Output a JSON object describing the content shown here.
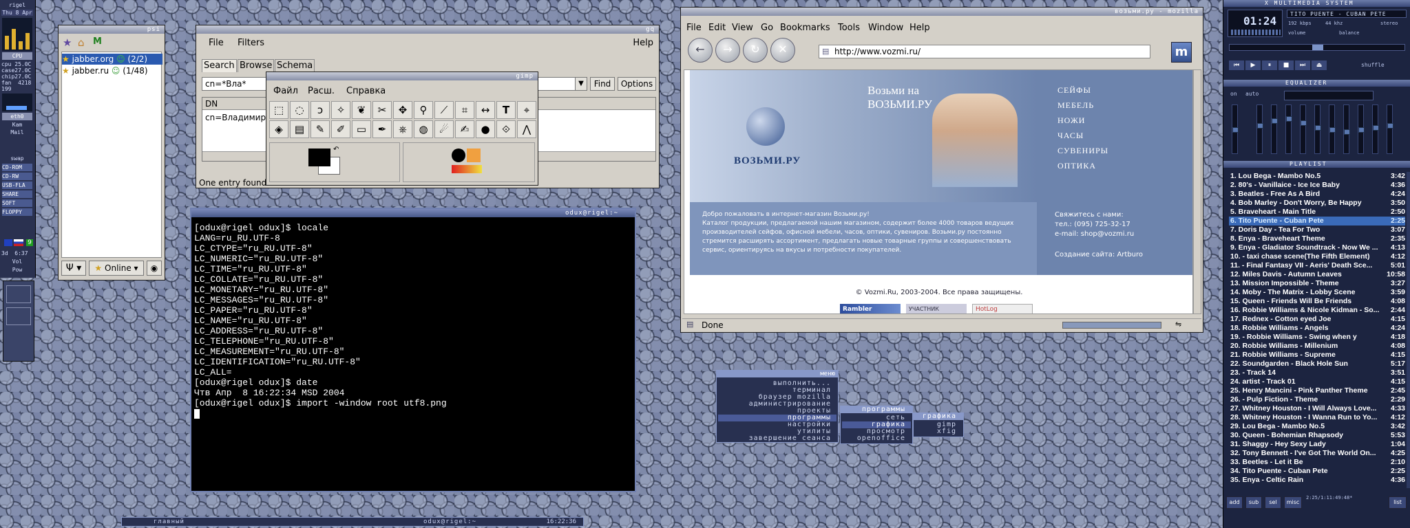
{
  "dock": {
    "host": "rigel",
    "date": "Thu 8 Apr",
    "cpu_label": "CPU",
    "cpu_lines": "cpu 25.0C\ncase27.0C\nchip27.0C\nfan  4218\n199",
    "net": "eth0",
    "net2": "Kam",
    "mail": "Mail",
    "swap": "swap",
    "drives": [
      "CD-ROM",
      "CD-RW",
      "USB-FLA",
      "SHARE",
      "SOFT",
      "FLOPPY"
    ],
    "clock": "3d  6:37",
    "kbd": "9",
    "vol": "Vol",
    "pow": "Pow"
  },
  "psi": {
    "title": "psi",
    "accounts": [
      {
        "name": "jabber.org",
        "count": "(2/2)"
      },
      {
        "name": "jabber.ru",
        "count": "(1/48)"
      }
    ],
    "status": "Online"
  },
  "gq": {
    "title": "gq",
    "menu": [
      "File",
      "Filters"
    ],
    "help": "Help",
    "tabs": [
      "Search",
      "Browse",
      "Schema"
    ],
    "search_value": "cn=*Вла*",
    "find_label": "Find",
    "options_label": "Options",
    "column_header": "DN",
    "result": "cn=Владимир",
    "status": "One entry found"
  },
  "gimp": {
    "title": "gimp",
    "menu": [
      "Файл",
      "Расш.",
      "Справка"
    ]
  },
  "terminal": {
    "title": "odux@rigel:~",
    "lines": [
      "[odux@rigel odux]$ locale",
      "LANG=ru_RU.UTF-8",
      "LC_CTYPE=\"ru_RU.UTF-8\"",
      "LC_NUMERIC=\"ru_RU.UTF-8\"",
      "LC_TIME=\"ru_RU.UTF-8\"",
      "LC_COLLATE=\"ru_RU.UTF-8\"",
      "LC_MONETARY=\"ru_RU.UTF-8\"",
      "LC_MESSAGES=\"ru_RU.UTF-8\"",
      "LC_PAPER=\"ru_RU.UTF-8\"",
      "LC_NAME=\"ru_RU.UTF-8\"",
      "LC_ADDRESS=\"ru_RU.UTF-8\"",
      "LC_TELEPHONE=\"ru_RU.UTF-8\"",
      "LC_MEASUREMENT=\"ru_RU.UTF-8\"",
      "LC_IDENTIFICATION=\"ru_RU.UTF-8\"",
      "LC_ALL=",
      "[odux@rigel odux]$ date",
      "Чтв Апр  8 16:22:34 MSD 2004",
      "[odux@rigel odux]$ import -window root utf8.png"
    ]
  },
  "mozilla": {
    "title": "возьми.ру - mozilla",
    "menu": [
      "File",
      "Edit",
      "View",
      "Go",
      "Bookmarks",
      "Tools",
      "Window",
      "Help"
    ],
    "url": "http://www.vozmi.ru/",
    "status": "Done",
    "page": {
      "brand": "ВОЗЬМИ.РУ",
      "headline_1": "Возьми на",
      "headline_2": "ВОЗЬМИ.РУ",
      "categories": [
        "СЕЙФЫ",
        "МЕБЕЛЬ",
        "НОЖИ",
        "ЧАСЫ",
        "СУВЕНИРЫ",
        "ОПТИКА"
      ],
      "welcome": "Добро пожаловать в интернет-магазин Возьми.ру!",
      "body": "Каталог продукции, предлагаемой нашим магазином, содержит более 4000 товаров ведущих производителей сейфов, офисной мебели, часов, оптики, сувениров. Возьми.ру постоянно стремится расширять ассортимент, предлагать новые товарные группы и совершенствовать сервис, ориентируясь на вкусы и потребности покупателей.",
      "contact_title": "Свяжитесь с нами:",
      "phone": "тел.: (095) 725-32-17",
      "email": "e-mail: shop@vozmi.ru",
      "made_by": "Создание сайта: Artburo",
      "copyright": "© Vozmi.Ru, 2003-2004. Все права защищены.",
      "banners": [
        "Rambler",
        "УЧАСТНИК",
        "HotLog"
      ]
    }
  },
  "context_menu": {
    "title": "меню",
    "items": [
      "выполнить...",
      "терминал",
      "браузер mozilla",
      "администрирование",
      "проекты",
      "программы",
      "настройки",
      "утилиты",
      "завершение сеанса"
    ],
    "selected": "программы",
    "sub1": [
      "программы",
      "сеть",
      "графика",
      "просмотр",
      "openoffice"
    ],
    "sub1_selected": "графика",
    "sub2": [
      "графика",
      "gimp",
      "xfig"
    ]
  },
  "taskbar": {
    "left": "главный",
    "center": "odux@rigel:~",
    "time": "16:22:36"
  },
  "xmms": {
    "title": "X MULTIMEDIA SYSTEM",
    "time": "01:24",
    "song": "TITO PUENTE - CUBAN PETE",
    "bitrate": "192 kbps",
    "khz": "44 khz",
    "volume_label": "volume",
    "balance_label": "balance",
    "stereo": "stereo",
    "shuffle": "shuffle",
    "equalizer_title": "EQUALIZER",
    "eq_on": "on",
    "eq_auto": "auto",
    "eq_levels": [
      0.5,
      0.6,
      0.7,
      0.75,
      0.65,
      0.55,
      0.5,
      0.45,
      0.5,
      0.55,
      0.6
    ],
    "playlist_title": "PLAYLIST",
    "selected_index": 5,
    "playlist": [
      {
        "title": "1. Lou Bega - Mambo No.5",
        "dur": "3:42"
      },
      {
        "title": "2. 80's - Vanillaice - Ice Ice Baby",
        "dur": "4:36"
      },
      {
        "title": "3. Beatles - Free As A Bird",
        "dur": "4:24"
      },
      {
        "title": "4. Bob Marley - Don't Worry, Be Happy",
        "dur": "3:50"
      },
      {
        "title": "5. Braveheart - Main Title",
        "dur": "2:50"
      },
      {
        "title": "6. Tito Puente - Cuban Pete",
        "dur": "2:25"
      },
      {
        "title": "7. Doris Day - Tea For Two",
        "dur": "3:07"
      },
      {
        "title": "8. Enya - Braveheart Theme",
        "dur": "2:35"
      },
      {
        "title": "9. Enya - Gladiator Soundtrack - Now We ...",
        "dur": "4:13"
      },
      {
        "title": "10. - taxi chase scene(The Fifth Element)",
        "dur": "4:12"
      },
      {
        "title": "11. - Final Fantasy VII - Aeris' Death Sce...",
        "dur": "5:01"
      },
      {
        "title": "12. Miles Davis - Autumn Leaves",
        "dur": "10:58"
      },
      {
        "title": "13. Mission Impossible - Theme",
        "dur": "3:27"
      },
      {
        "title": "14. Moby - The Matrix - Lobby Scene",
        "dur": "3:59"
      },
      {
        "title": "15. Queen - Friends Will Be Friends",
        "dur": "4:08"
      },
      {
        "title": "16. Robbie Williams & Nicole Kidman - So...",
        "dur": "2:44"
      },
      {
        "title": "17. Rednex - Cotton eyed Joe",
        "dur": "4:15"
      },
      {
        "title": "18. Robbie Williams - Angels",
        "dur": "4:24"
      },
      {
        "title": "19. - Robbie Williams - Swing when y",
        "dur": "4:18"
      },
      {
        "title": "20. Robbie Williams - Millenium",
        "dur": "4:08"
      },
      {
        "title": "21. Robbie Williams - Supreme",
        "dur": "4:15"
      },
      {
        "title": "22. Soundgarden - Black Hole Sun",
        "dur": "5:17"
      },
      {
        "title": "23. - Track 14",
        "dur": "3:51"
      },
      {
        "title": "24. artist - Track 01",
        "dur": "4:15"
      },
      {
        "title": "25. Henry Mancini - Pink Panther Theme",
        "dur": "2:45"
      },
      {
        "title": "26. - Pulp Fiction - Theme",
        "dur": "2:29"
      },
      {
        "title": "27. Whitney Houston - I Will Always Love...",
        "dur": "4:33"
      },
      {
        "title": "28. Whitney Houston - I Wanna Run to Yo...",
        "dur": "4:12"
      },
      {
        "title": "29. Lou Bega - Mambo No.5",
        "dur": "3:42"
      },
      {
        "title": "30. Queen - Bohemian Rhapsody",
        "dur": "5:53"
      },
      {
        "title": "31. Shaggy - Hey Sexy Lady",
        "dur": "1:04"
      },
      {
        "title": "32. Tony Bennett - I've Got The World On...",
        "dur": "4:25"
      },
      {
        "title": "33. Beetles - Let it Be",
        "dur": "2:10"
      },
      {
        "title": "34. Tito Puente - Cuban Pete",
        "dur": "2:25"
      },
      {
        "title": "35. Enya - Celtic Rain",
        "dur": "4:36"
      }
    ],
    "pl_buttons": [
      "add",
      "sub",
      "sel",
      "misc",
      "list"
    ],
    "pl_info": "2:25/1:11:49:48*"
  },
  "colors": {
    "xmms_bg": "#1c2440",
    "selection": "#3a6ab8",
    "accent": "#5870a8"
  }
}
